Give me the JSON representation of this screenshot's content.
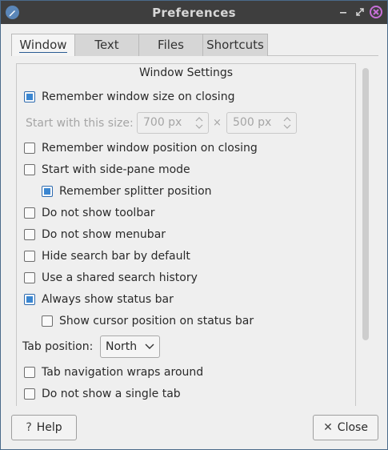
{
  "window": {
    "title": "Preferences"
  },
  "tabs": [
    {
      "label": "Window",
      "active": true
    },
    {
      "label": "Text",
      "active": false
    },
    {
      "label": "Files",
      "active": false
    },
    {
      "label": "Shortcuts",
      "active": false
    }
  ],
  "section": {
    "title": "Window Settings"
  },
  "options": {
    "remember_size": {
      "label": "Remember window size on closing",
      "checked": true
    },
    "start_size_label": "Start with this size:",
    "width_value": "700 px",
    "height_value": "500 px",
    "times": "×",
    "remember_position": {
      "label": "Remember window position on closing",
      "checked": false
    },
    "side_pane": {
      "label": "Start with side-pane mode",
      "checked": false
    },
    "remember_splitter": {
      "label": "Remember splitter position",
      "checked": true
    },
    "no_toolbar": {
      "label": "Do not show toolbar",
      "checked": false
    },
    "no_menubar": {
      "label": "Do not show menubar",
      "checked": false
    },
    "hide_search": {
      "label": "Hide search bar by default",
      "checked": false
    },
    "shared_history": {
      "label": "Use a shared search history",
      "checked": false
    },
    "status_bar": {
      "label": "Always show status bar",
      "checked": true
    },
    "cursor_pos": {
      "label": "Show cursor position on status bar",
      "checked": false
    },
    "tab_position_label": "Tab position:",
    "tab_position_value": "North",
    "tab_wrap": {
      "label": "Tab navigation wraps around",
      "checked": false
    },
    "single_tab": {
      "label": "Do not show a single tab",
      "checked": false
    }
  },
  "buttons": {
    "help": {
      "label": "Help",
      "glyph": "?"
    },
    "close": {
      "label": "Close",
      "glyph": "✕"
    }
  },
  "colors": {
    "accent": "#3a86d1",
    "titlebar": "#3e3e3e",
    "close_icon": "#c76fd8"
  }
}
